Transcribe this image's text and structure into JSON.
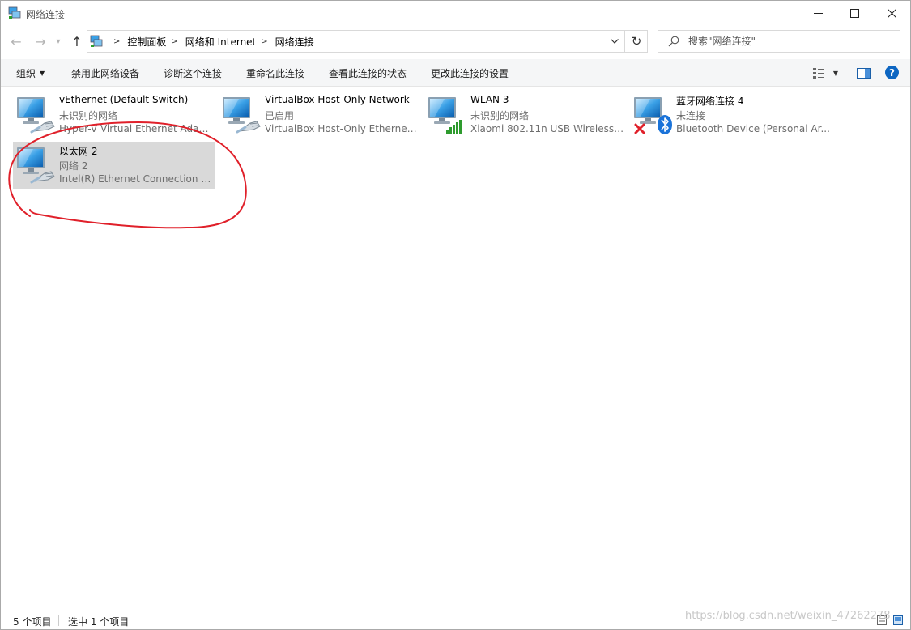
{
  "window": {
    "title": "网络连接",
    "icons": {
      "app": "network-connections-icon",
      "minimize": "minimize-icon",
      "maximize": "maximize-icon",
      "close": "close-icon"
    }
  },
  "nav": {
    "back_icon": "arrow-left-icon",
    "forward_icon": "arrow-right-icon",
    "recent_icon": "chevron-down-icon",
    "up_icon": "arrow-up-icon",
    "breadcrumbs": [
      "控制面板",
      "网络和 Internet",
      "网络连接"
    ],
    "refresh_icon": "refresh-icon"
  },
  "search": {
    "placeholder": "搜索\"网络连接\"",
    "icon": "search-icon"
  },
  "toolbar": {
    "organize": "组织",
    "disable": "禁用此网络设备",
    "diagnose": "诊断这个连接",
    "rename": "重命名此连接",
    "view_status": "查看此连接的状态",
    "change_settings": "更改此连接的设置",
    "view_options_icon": "view-options-icon",
    "preview_pane_icon": "preview-pane-icon",
    "help_label": "?"
  },
  "connections": [
    {
      "name": "vEthernet (Default Switch)",
      "status": "未识别的网络",
      "device": "Hyper-V Virtual Ethernet Adap...",
      "icon": "ethernet-adapter-icon",
      "selected": false
    },
    {
      "name": "VirtualBox Host-Only Network",
      "status": "已启用",
      "device": "VirtualBox Host-Only Ethernet ...",
      "icon": "ethernet-adapter-icon",
      "selected": false
    },
    {
      "name": "WLAN 3",
      "status": "未识别的网络",
      "device": "Xiaomi 802.11n USB Wireless ...",
      "icon": "wifi-adapter-icon",
      "selected": false
    },
    {
      "name": "蓝牙网络连接 4",
      "status": "未连接",
      "device": "Bluetooth Device (Personal Ar...",
      "icon": "bluetooth-adapter-icon",
      "selected": false
    },
    {
      "name": "以太网 2",
      "status": "网络 2",
      "device": "Intel(R) Ethernet Connection (5...",
      "icon": "ethernet-adapter-icon",
      "selected": true
    }
  ],
  "status_bar": {
    "item_count": "5 个项目",
    "selected_count": "选中 1 个项目",
    "watermark": "https://blog.csdn.net/weixin_47262278"
  },
  "colors": {
    "selection": "#d9d9d9",
    "annotation": "#e0202a",
    "help_button": "#0d66c2",
    "secondary_text": "#6d6d6d"
  }
}
